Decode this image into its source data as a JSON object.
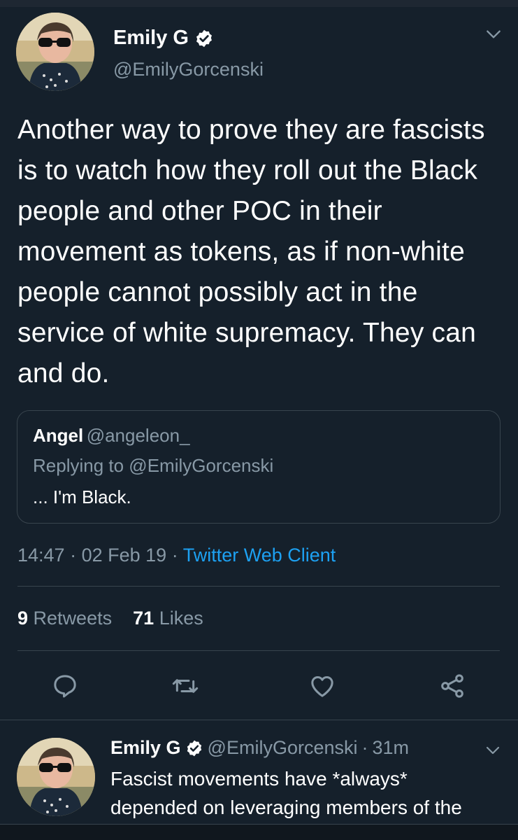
{
  "tweet": {
    "author_name": "Emily G",
    "author_handle": "@EmilyGorcenski",
    "text": "Another way to prove they are fascists is to watch how they roll out the Black people and other POC in their movement as tokens, as if non-white people cannot possibly act in the service of white supremacy. They can and do.",
    "quoted": {
      "name": "Angel",
      "handle": "@angeleon_",
      "replying_to": "Replying to @EmilyGorcenski",
      "text": "... I'm Black."
    },
    "time": "14:47",
    "date": "02 Feb 19",
    "separator": "·",
    "client": "Twitter Web Client",
    "retweets_count": "9",
    "retweets_label": "Retweets",
    "likes_count": "71",
    "likes_label": "Likes"
  },
  "reply_tweet": {
    "author_name": "Emily G",
    "author_handle": "@EmilyGorcenski",
    "separator": "·",
    "age": "31m",
    "text_line1": "Fascist movements have *always*",
    "text_line2": "depended on leveraging members of the"
  },
  "icons": {
    "verified": "verified-badge-icon",
    "menu": "chevron-down-icon",
    "reply": "reply-icon",
    "retweet": "retweet-icon",
    "like": "heart-icon",
    "share": "share-icon"
  },
  "colors": {
    "background": "#15202b",
    "secondary_text": "#8899a6",
    "accent": "#1da1f2",
    "divider": "#38444d"
  }
}
